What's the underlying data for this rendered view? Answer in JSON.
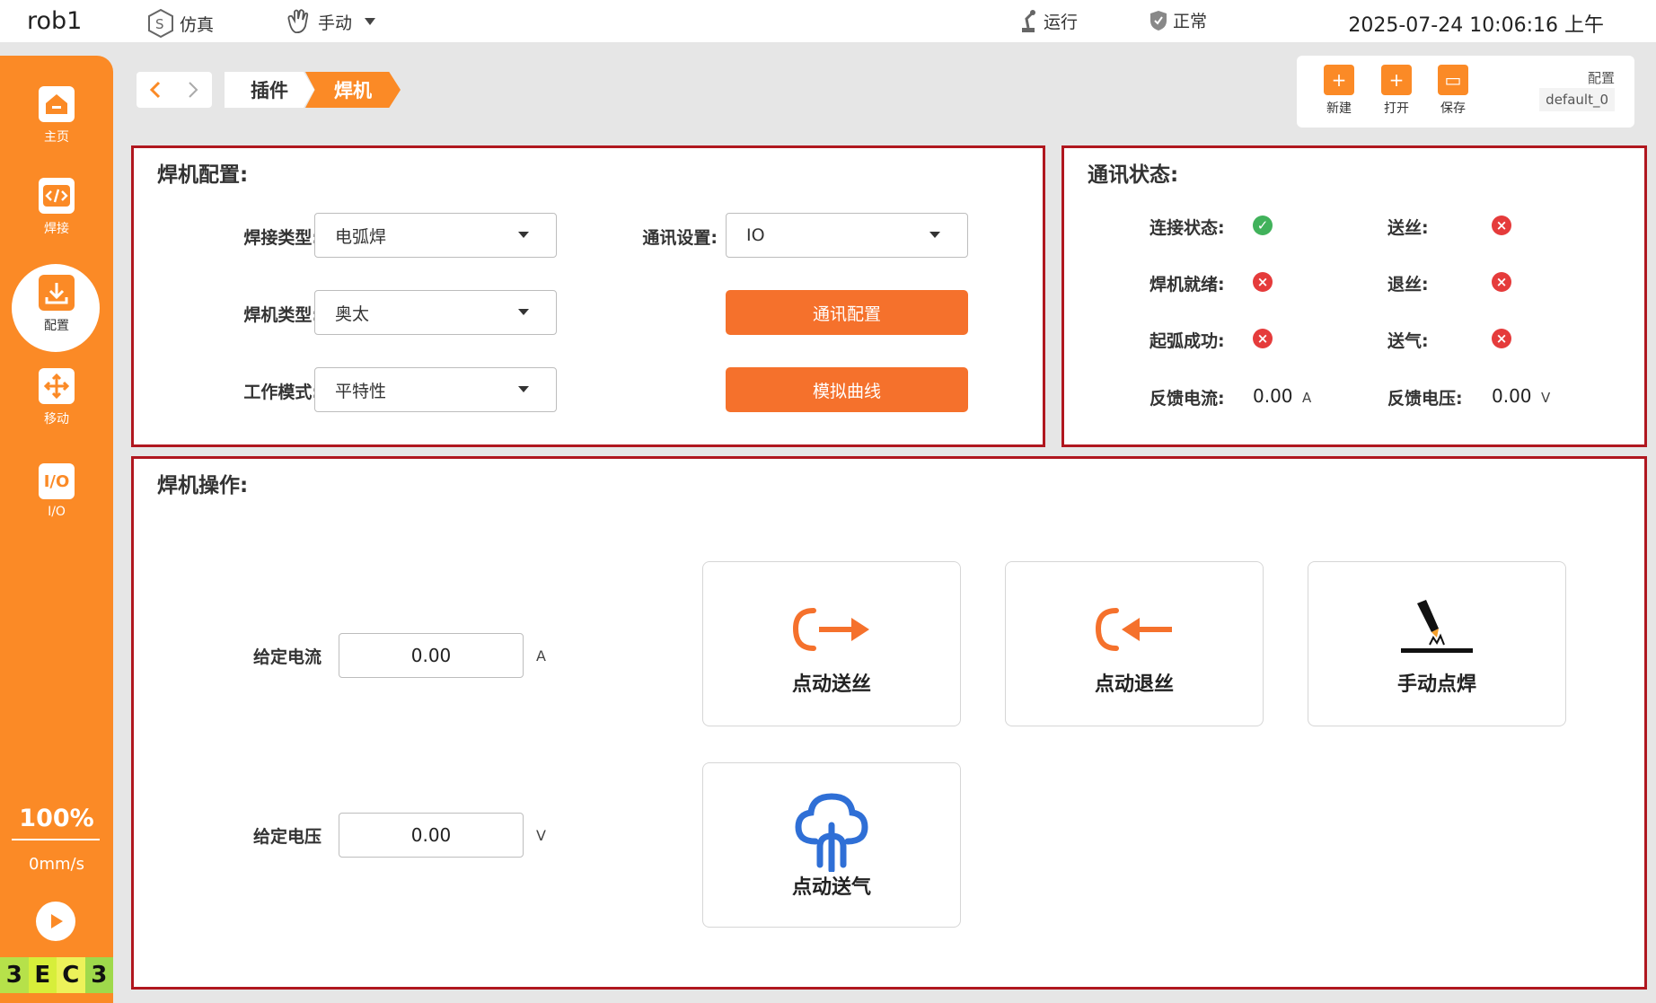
{
  "topbar": {
    "robot": "rob1",
    "sim_label": "仿真",
    "mode_label": "手动",
    "run_label": "运行",
    "status_label": "正常",
    "datetime": "2025-07-24 10:06:16 上午"
  },
  "sidebar": {
    "items": [
      {
        "label": "主页",
        "icon": "home-icon"
      },
      {
        "label": "焊接",
        "icon": "code-icon"
      },
      {
        "label": "配置",
        "icon": "config-icon"
      },
      {
        "label": "移动",
        "icon": "move-icon"
      },
      {
        "label": "I/O",
        "icon": "io-icon"
      }
    ],
    "speed_percent": "100%",
    "speed_value": "0mm/s",
    "logo": [
      "3",
      "E",
      "C",
      "3"
    ]
  },
  "breadcrumb": {
    "items": [
      "插件",
      "焊机"
    ]
  },
  "filebar": {
    "new_label": "新建",
    "open_label": "打开",
    "save_label": "保存",
    "config_label": "配置",
    "config_value": "default_0"
  },
  "welder_config": {
    "title": "焊机配置:",
    "weld_type_label": "焊接类型:",
    "weld_type_value": "电弧焊",
    "welder_type_label": "焊机类型:",
    "welder_type_value": "奥太",
    "work_mode_label": "工作模式:",
    "work_mode_value": "平特性",
    "comm_setting_label": "通讯设置:",
    "comm_setting_value": "IO",
    "comm_config_button": "通讯配置",
    "sim_curve_button": "模拟曲线"
  },
  "comm_status": {
    "title": "通讯状态:",
    "connect_label": "连接状态:",
    "connect_status": "ok",
    "ready_label": "焊机就绪:",
    "ready_status": "error",
    "arc_label": "起弧成功:",
    "arc_status": "error",
    "feed_label": "送丝:",
    "feed_status": "error",
    "retract_label": "退丝:",
    "retract_status": "error",
    "gas_label": "送气:",
    "gas_status": "error",
    "fb_current_label": "反馈电流:",
    "fb_current_value": "0.00",
    "fb_current_unit": "A",
    "fb_voltage_label": "反馈电压:",
    "fb_voltage_value": "0.00",
    "fb_voltage_unit": "V"
  },
  "welder_ops": {
    "title": "焊机操作:",
    "set_current_label": "给定电流",
    "set_current_value": "0.00",
    "set_current_unit": "A",
    "set_voltage_label": "给定电压",
    "set_voltage_value": "0.00",
    "set_voltage_unit": "V",
    "jog_feed_label": "点动送丝",
    "jog_retract_label": "点动退丝",
    "manual_spot_label": "手动点焊",
    "jog_gas_label": "点动送气"
  },
  "colors": {
    "accent": "#fb8a26",
    "button": "#f5712c",
    "panel_border": "#b0171f",
    "ok": "#41b25b",
    "error": "#e53b3b",
    "gas_icon": "#2f6fd6"
  }
}
